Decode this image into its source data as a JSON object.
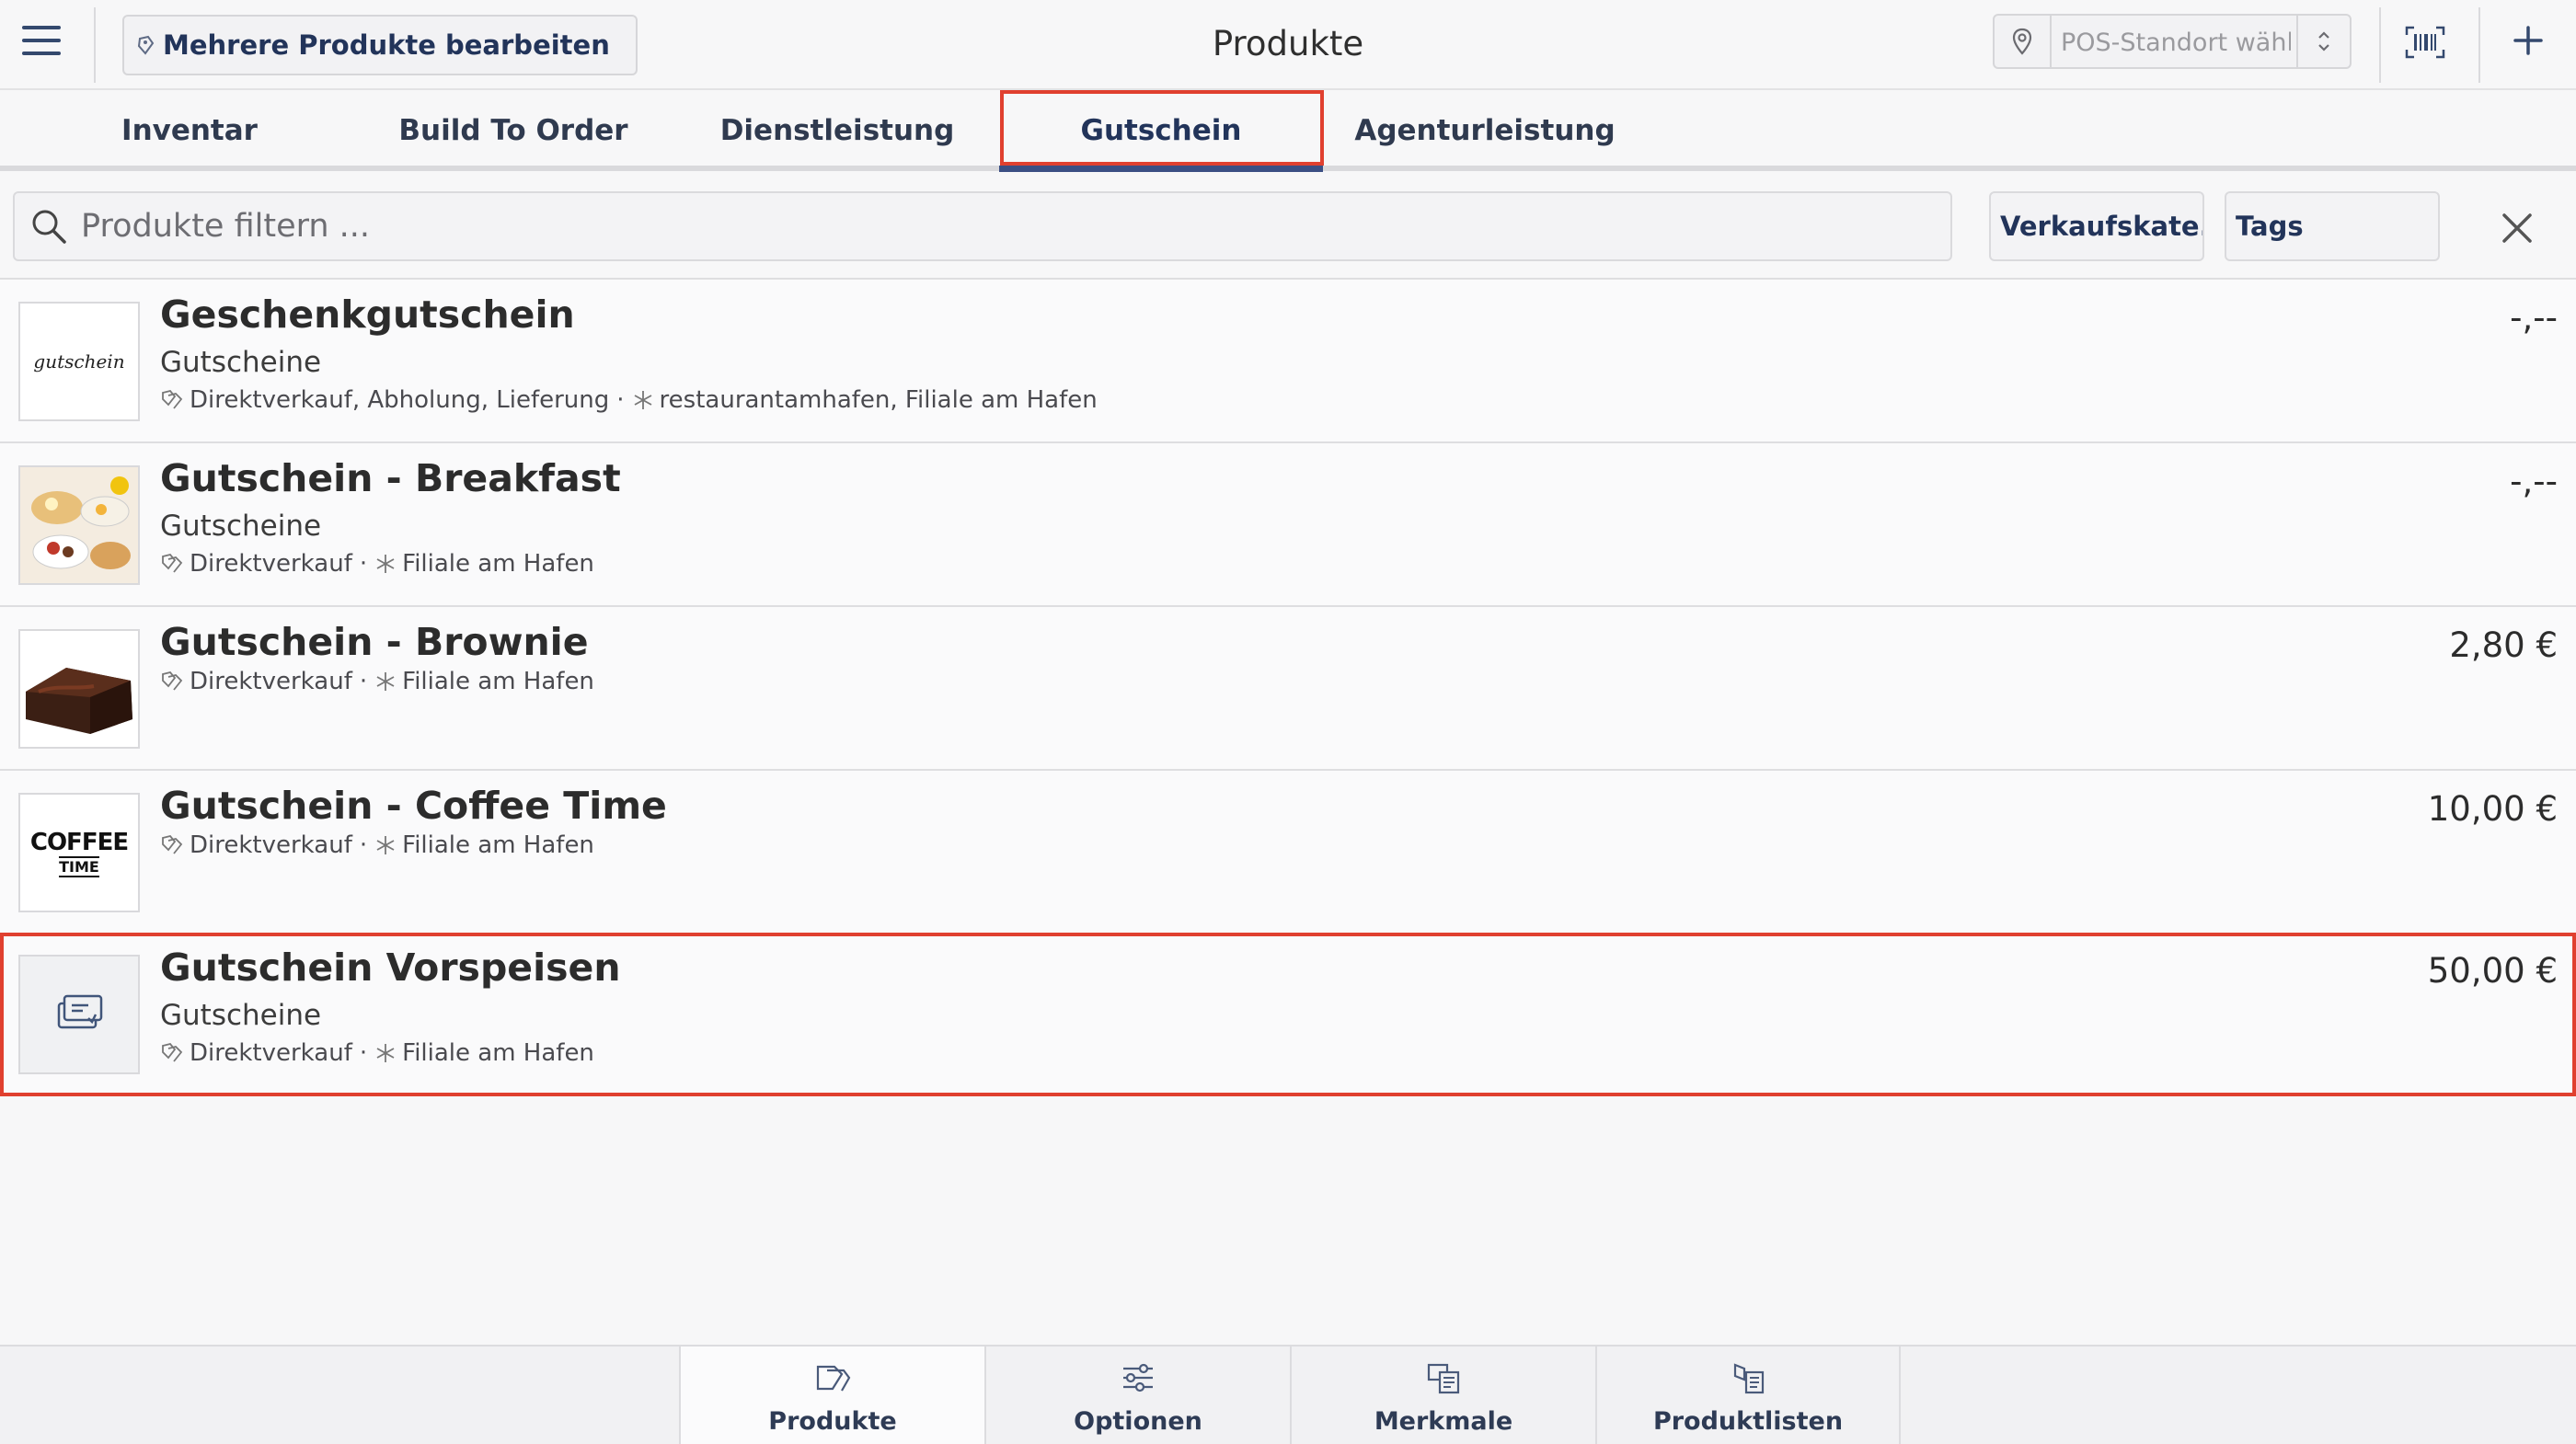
{
  "header": {
    "title": "Produkte",
    "edit_button": "Mehrere Produkte bearbeiten",
    "location_placeholder": "POS-Standort wählen..."
  },
  "tabs": [
    "Inventar",
    "Build To Order",
    "Dienstleistung",
    "Gutschein",
    "Agenturleistung"
  ],
  "active_tab": "Gutschein",
  "filter": {
    "search_placeholder": "Produkte filtern ...",
    "category_button": "Verkaufskate...",
    "tags_button": "Tags"
  },
  "products": [
    {
      "name": "Geschenkgutschein",
      "category": "Gutscheine",
      "channels": "Direktverkauf, Abholung, Lieferung",
      "locations": "restaurantamhafen, Filiale am Hafen",
      "price": "-,--",
      "thumb_text": "gutschein"
    },
    {
      "name": "Gutschein - Breakfast",
      "category": "Gutscheine",
      "channels": "Direktverkauf",
      "locations": "Filiale am Hafen",
      "price": "-,--"
    },
    {
      "name": "Gutschein - Brownie",
      "category": "",
      "channels": "Direktverkauf",
      "locations": "Filiale am Hafen",
      "price": "2,80 €"
    },
    {
      "name": "Gutschein - Coffee Time",
      "category": "",
      "channels": "Direktverkauf",
      "locations": "Filiale am Hafen",
      "price": "10,00 €",
      "thumb_text": {
        "line1": "COFFEE",
        "line2": "TIME"
      }
    },
    {
      "name": "Gutschein Vorspeisen",
      "category": "Gutscheine",
      "channels": "Direktverkauf",
      "locations": "Filiale am Hafen",
      "price": "50,00 €"
    }
  ],
  "bottom_nav": [
    "Produkte",
    "Optionen",
    "Merkmale",
    "Produktlisten"
  ],
  "colors": {
    "accent": "#22345a",
    "highlight": "#e0402f",
    "tab_underline": "#3b4f84",
    "background": "#f7f7f8"
  },
  "icons": {
    "menu": "hamburger-icon",
    "location": "map-pin-icon",
    "barcode": "barcode-scanner-icon",
    "add": "plus-icon",
    "search": "search-icon",
    "clear": "close-icon",
    "channel": "tags-icon",
    "location_meta": "snowflake-icon"
  }
}
